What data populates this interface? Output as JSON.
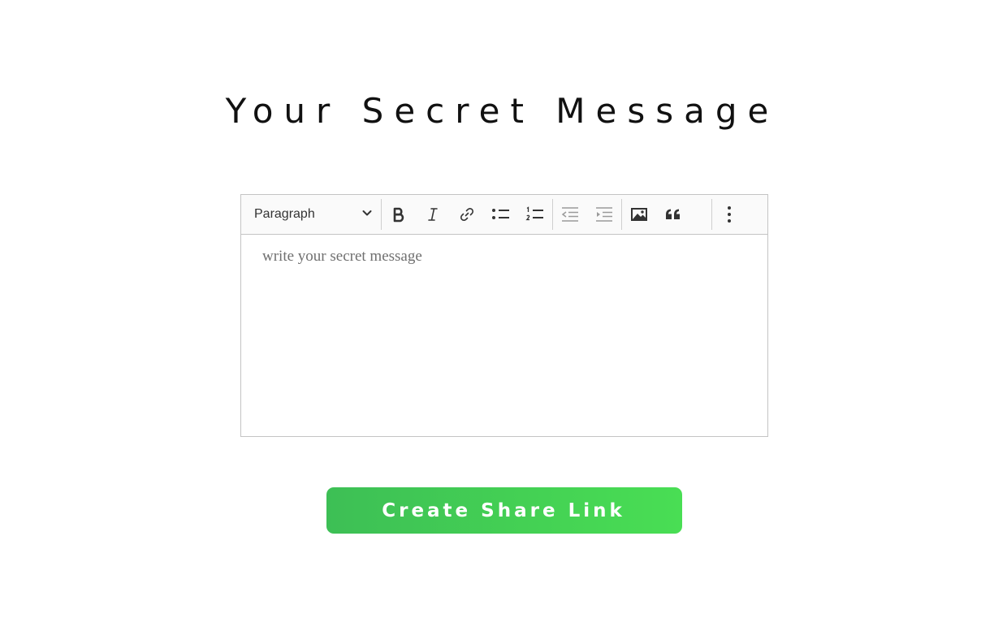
{
  "page": {
    "title": "Your Secret Message"
  },
  "editor": {
    "toolbar": {
      "heading_select": {
        "value": "Paragraph",
        "icon": "chevron-down-icon"
      },
      "buttons": [
        {
          "name": "bold",
          "icon": "bold-icon"
        },
        {
          "name": "italic",
          "icon": "italic-icon"
        },
        {
          "name": "link",
          "icon": "link-icon"
        },
        {
          "name": "bulleted-list",
          "icon": "bulleted-list-icon"
        },
        {
          "name": "numbered-list",
          "icon": "numbered-list-icon"
        },
        {
          "name": "outdent",
          "icon": "outdent-icon"
        },
        {
          "name": "indent",
          "icon": "indent-icon"
        },
        {
          "name": "insert-image",
          "icon": "image-icon"
        },
        {
          "name": "block-quote",
          "icon": "quote-icon"
        },
        {
          "name": "more",
          "icon": "more-vertical-icon"
        }
      ]
    },
    "placeholder": "write your secret message"
  },
  "actions": {
    "create_label": "Create Share Link"
  },
  "colors": {
    "button_gradient_start": "#3dbf55",
    "button_gradient_end": "#49de54",
    "toolbar_background": "#fafafa",
    "border": "#c4c4c4"
  }
}
